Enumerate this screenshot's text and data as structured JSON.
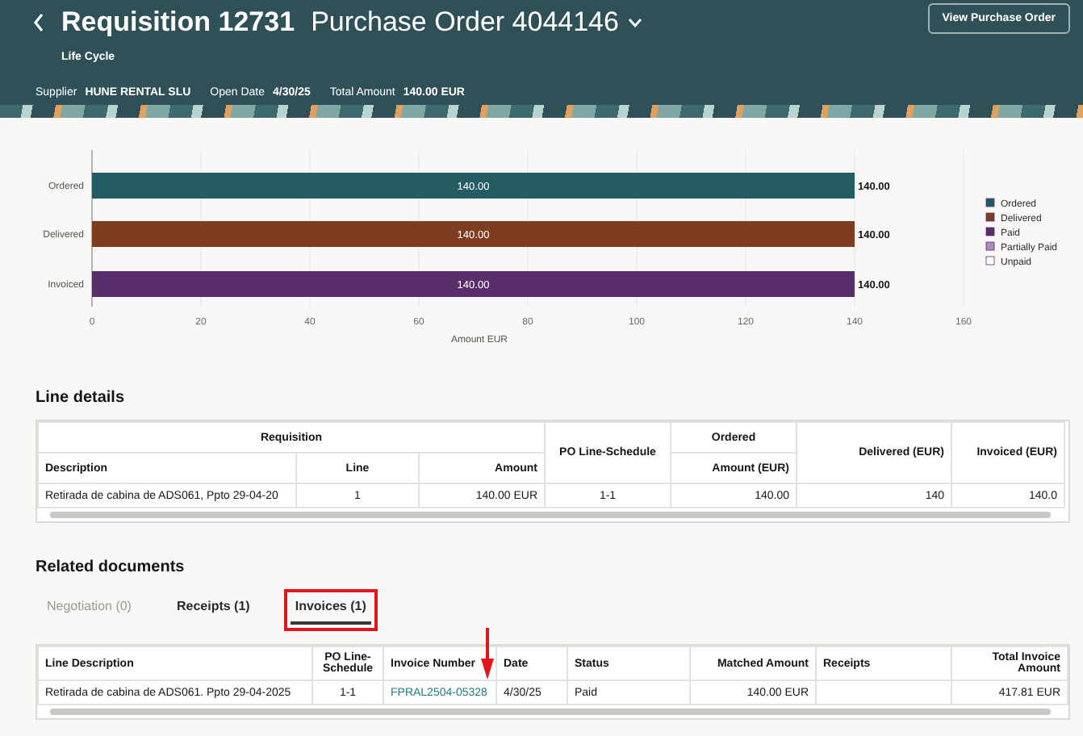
{
  "header": {
    "title": "Requisition 12731",
    "subtitle": "Purchase Order 4044146",
    "caption": "Life Cycle",
    "button": "View Purchase Order",
    "facts": [
      {
        "label": "Supplier",
        "value": "HUNE RENTAL SLU"
      },
      {
        "label": "Open Date",
        "value": "4/30/25"
      },
      {
        "label": "Total Amount",
        "value": "140.00 EUR"
      }
    ]
  },
  "chart": {
    "chart_data": {
      "type": "bar",
      "orientation": "horizontal",
      "stacked": true,
      "xlabel": "Amount EUR",
      "categories": [
        "Ordered",
        "Delivered",
        "Invoiced"
      ],
      "series": [
        {
          "name": "Ordered",
          "color": "#235d63",
          "values": [
            140,
            null,
            null
          ]
        },
        {
          "name": "Delivered",
          "color": "#7e3d1e",
          "values": [
            null,
            140,
            null
          ]
        },
        {
          "name": "Paid",
          "color": "#5a2d6b",
          "values": [
            null,
            null,
            140
          ]
        }
      ],
      "xlim": [
        0,
        160
      ],
      "xticks": [
        0,
        20,
        40,
        60,
        80,
        100,
        120,
        140,
        160
      ],
      "grid": true,
      "value_labels": [
        "140.00",
        "140.00",
        "140.00"
      ],
      "legend": {
        "extra": [
          {
            "label": "Partially Paid",
            "color": "#a98cbd"
          },
          {
            "label": "Unpaid",
            "color": "#ffffff"
          }
        ]
      }
    }
  },
  "line_details": {
    "title": "Line details",
    "column_groups": [
      {
        "label": "Requisition",
        "columns": [
          "Description",
          "Line",
          "Amount"
        ]
      },
      {
        "label": "PO Line-Schedule"
      },
      {
        "label": "Ordered",
        "columns": [
          "Amount (EUR)"
        ]
      },
      {
        "label": "Delivered (EUR)"
      },
      {
        "label": "Invoiced (EUR)"
      }
    ],
    "rows": [
      [
        "Retirada de cabina de ADS061, Ppto 29-04-20",
        "1",
        "140.00 EUR",
        "1-1",
        "140.00",
        "140",
        "140.0"
      ]
    ]
  },
  "related_documents": {
    "title": "Related documents",
    "tabs": [
      {
        "label": "Negotiation (0)",
        "selected": false,
        "disabled": true,
        "highlighted": false
      },
      {
        "label": "Receipts (1)",
        "selected": false,
        "disabled": false,
        "highlighted": false
      },
      {
        "label": "Invoices (1)",
        "selected": true,
        "disabled": false,
        "highlighted": true
      }
    ],
    "callout_arrow": true,
    "columns": [
      "Line Description",
      "PO Line-Schedule",
      "Invoice Number",
      "Date",
      "Status",
      "Matched Amount",
      "Receipts",
      "Total Invoice Amount"
    ],
    "rows": [
      {
        "cells": [
          {
            "text": "Retirada de cabina de ADS061. Ppto 29-04-2025",
            "kind": "text"
          },
          {
            "text": "1-1",
            "kind": "text"
          },
          {
            "text": "FPRAL2504-05328",
            "kind": "link"
          },
          {
            "text": "4/30/25",
            "kind": "text"
          },
          {
            "text": "Paid",
            "kind": "text"
          },
          {
            "text": "140.00 EUR",
            "kind": "text"
          },
          {
            "kind": "empty"
          },
          {
            "text": "417.81 EUR",
            "kind": "text"
          }
        ]
      }
    ]
  }
}
